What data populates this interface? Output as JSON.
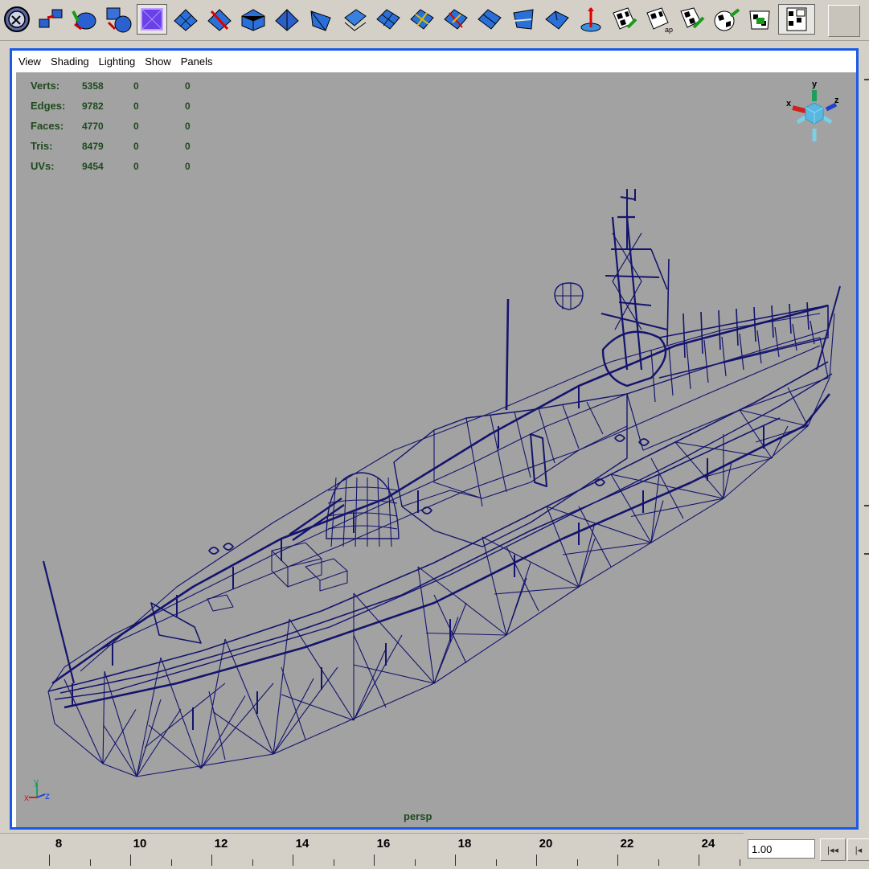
{
  "viewport_menu": [
    "View",
    "Shading",
    "Lighting",
    "Show",
    "Panels"
  ],
  "hud": {
    "rows": [
      {
        "label": "Verts:",
        "values": [
          "5358",
          "0",
          "0"
        ]
      },
      {
        "label": "Edges:",
        "values": [
          "9782",
          "0",
          "0"
        ]
      },
      {
        "label": "Faces:",
        "values": [
          "4770",
          "0",
          "0"
        ]
      },
      {
        "label": "Tris:",
        "values": [
          "8479",
          "0",
          "0"
        ]
      },
      {
        "label": "UVs:",
        "values": [
          "9454",
          "0",
          "0"
        ]
      }
    ]
  },
  "camera_name": "persp",
  "view_cube_axes": {
    "x": "x",
    "y": "y",
    "z": "z"
  },
  "origin_axes": {
    "x": "x",
    "y": "y",
    "z": "z"
  },
  "timeline": {
    "labels": [
      "8",
      "10",
      "12",
      "14",
      "16",
      "18",
      "20",
      "22",
      "24"
    ],
    "current_frame": "1.00"
  },
  "toolbar_icons": [
    "select-tool-icon",
    "merge-components-icon",
    "extrude-icon",
    "split-polygon-icon",
    "cube-primitive-icon",
    "polygon-plane-icon",
    "cut-faces-icon",
    "bevel-icon",
    "wedge-face-icon",
    "poke-face-icon",
    "duplicate-face-icon",
    "smooth-icon",
    "subdivide-icon",
    "split-edge-icon",
    "insert-edge-loop-icon",
    "append-polygon-icon",
    "wedge-icon",
    "fill-hole-icon",
    "transform-component-icon",
    "uv-checker-icon",
    "uv-map-icon",
    "uv-layout-icon",
    "uv-sphere-map-icon",
    "uv-relax-icon",
    "uv-editor-icon"
  ],
  "colors": {
    "viewport_bg": "#a2a2a2",
    "wireframe": "#14146e",
    "panel_border": "#1a5ae8",
    "hud_text": "#1e4a1e"
  }
}
